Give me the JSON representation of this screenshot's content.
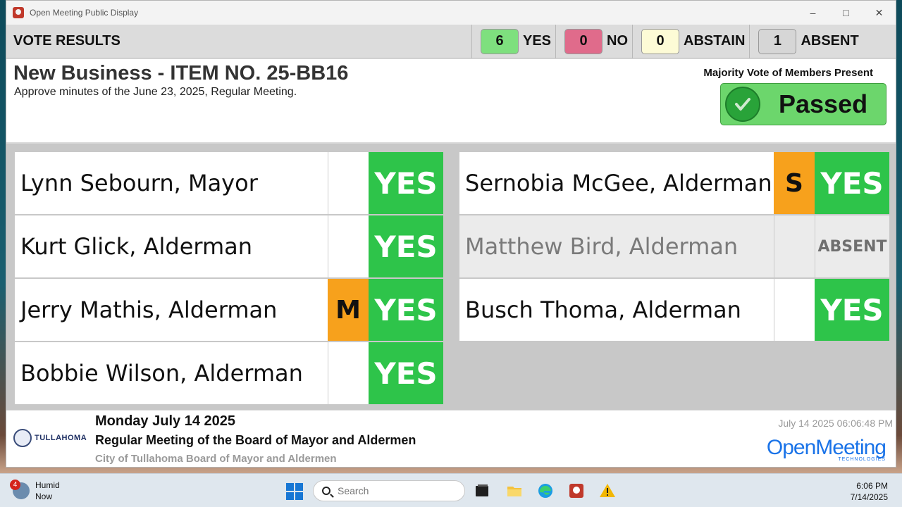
{
  "window": {
    "title": "Open Meeting Public Display"
  },
  "header": {
    "title": "VOTE RESULTS",
    "tallies": [
      {
        "count": "6",
        "label": "YES",
        "color": "#7ee07e"
      },
      {
        "count": "0",
        "label": "NO",
        "color": "#e06b8b"
      },
      {
        "count": "0",
        "label": "ABSTAIN",
        "color": "#fdfbd6"
      },
      {
        "count": "1",
        "label": "ABSENT",
        "color": "#d6d6d6"
      }
    ]
  },
  "item": {
    "title": "New Business - ITEM NO. 25-BB16",
    "description": "Approve minutes of the June 23, 2025, Regular Meeting.",
    "vote_rule": "Majority Vote of Members Present",
    "result": "Passed"
  },
  "members": [
    {
      "name": "Lynn Sebourn, Mayor",
      "tag": "",
      "vote": "YES"
    },
    {
      "name": "Kurt Glick, Alderman",
      "tag": "",
      "vote": "YES"
    },
    {
      "name": "Jerry Mathis, Alderman",
      "tag": "M",
      "vote": "YES"
    },
    {
      "name": "Bobbie Wilson, Alderman",
      "tag": "",
      "vote": "YES"
    },
    {
      "name": "Sernobia McGee, Alderman",
      "tag": "S",
      "vote": "YES"
    },
    {
      "name": "Matthew Bird, Alderman",
      "tag": "",
      "vote": "ABSENT"
    },
    {
      "name": "Busch Thoma, Alderman",
      "tag": "",
      "vote": "YES"
    }
  ],
  "footer": {
    "city_logo": "TULLAHOMA",
    "date": "Monday July 14 2025",
    "meeting": "Regular Meeting of the Board of Mayor and Aldermen",
    "body": "City of Tullahoma Board of Mayor and Aldermen",
    "timestamp": "July 14 2025 06:06:48 PM",
    "brand": "OpenMeeting",
    "brand_sub": "TECHNOLOGIES"
  },
  "taskbar": {
    "weather_badge": "4",
    "weather_title": "Humid",
    "weather_sub": "Now",
    "search_placeholder": "Search",
    "time": "6:06 PM",
    "date": "7/14/2025"
  }
}
